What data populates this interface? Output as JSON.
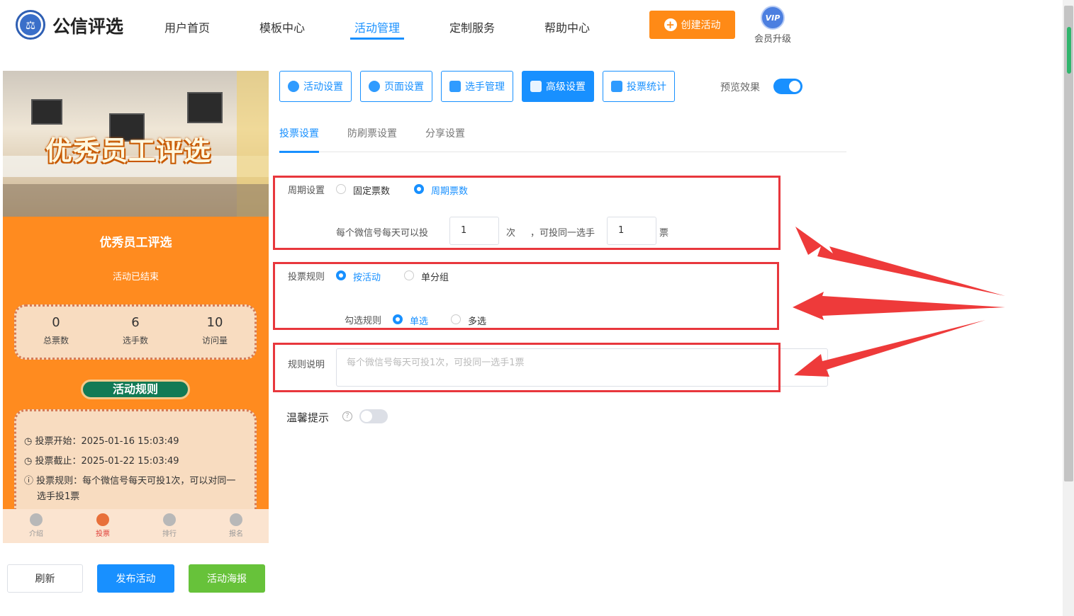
{
  "brand": {
    "name": "公信评选"
  },
  "nav": {
    "items": [
      "用户首页",
      "模板中心",
      "活动管理",
      "定制服务",
      "帮助中心"
    ],
    "active_index": 2
  },
  "header": {
    "create_label": "创建活动",
    "vip_badge": "VIP",
    "vip_label": "会员升级"
  },
  "phone": {
    "banner_title": "优秀员工评选",
    "title": "优秀员工评选",
    "status": "活动已结束",
    "stats": [
      {
        "value": "0",
        "label": "总票数"
      },
      {
        "value": "6",
        "label": "选手数"
      },
      {
        "value": "10",
        "label": "访问量"
      }
    ],
    "rules_title": "活动规则",
    "rules": [
      {
        "icon": "clock-icon",
        "text": "投票开始：2025-01-16 15:03:49"
      },
      {
        "icon": "clock-icon",
        "text": "投票截止：2025-01-22 15:03:49"
      },
      {
        "icon": "info-icon",
        "text": "投票规则：每个微信号每天可投1次，可以对同一选手投1票"
      }
    ],
    "tabs": [
      "介绍",
      "投票",
      "排行",
      "报名"
    ],
    "active_tab": 1
  },
  "actions": {
    "refresh": "刷新",
    "publish": "发布活动",
    "poster": "活动海报"
  },
  "panel_tabs": [
    "活动设置",
    "页面设置",
    "选手管理",
    "高级设置",
    "投票统计"
  ],
  "panel_active": 3,
  "preview": {
    "label": "预览效果",
    "enabled": true
  },
  "sub_tabs": [
    "投票设置",
    "防刷票设置",
    "分享设置"
  ],
  "cycle": {
    "label": "周期设置",
    "options": [
      "固定票数",
      "周期票数"
    ],
    "selected": 1,
    "row_prefix": "每个微信号每天可以投",
    "times_value": "1",
    "times_unit": "次",
    "mid_text": "，可投同一选手",
    "votes_value": "1",
    "votes_unit": "票"
  },
  "vote_rule": {
    "label": "投票规则",
    "options": [
      "按活动",
      "单分组"
    ],
    "selected": 0,
    "check_label": "勾选规则",
    "check_options": [
      "单选",
      "多选"
    ],
    "check_selected": 0
  },
  "rule_desc": {
    "label": "规则说明",
    "placeholder": "每个微信号每天可投1次，可投同一选手1票"
  },
  "tip": {
    "label": "温馨提示",
    "enabled": false
  },
  "colors": {
    "accent": "#1890ff",
    "orange": "#ff8a16",
    "green": "#67c23a",
    "highlight": "#e8373d"
  }
}
